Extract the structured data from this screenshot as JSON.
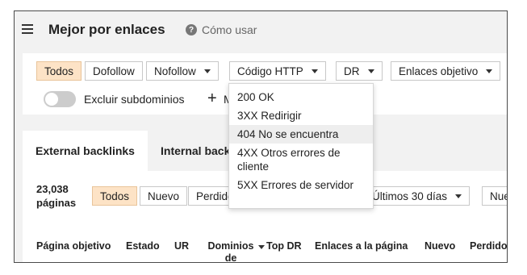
{
  "header": {
    "title": "Mejor por enlaces",
    "help_label": "Cómo usar"
  },
  "filters": {
    "link_type": [
      "Todos",
      "Dofollow",
      "Nofollow"
    ],
    "http_code_label": "Código HTTP",
    "dr_label": "DR",
    "target_links_label": "Enlaces objetivo",
    "exclude_subdomains_label": "Excluir subdominios",
    "exclude_subdomains_on": false,
    "add_filter_partial": "M"
  },
  "http_dropdown": {
    "options": [
      "200 OK",
      "3XX Redirigir",
      "404 No se encuentra",
      "4XX Otros errores de cliente",
      "5XX Errores de servidor"
    ],
    "hovered": "404 No se encuentra"
  },
  "tabs": [
    "External backlinks",
    "Internal backlinks"
  ],
  "results": {
    "count": "23,038",
    "unit": "páginas",
    "segments": [
      "Todos",
      "Nuevo",
      "Perdido"
    ],
    "period_label": "Últimos 30 días",
    "cut_button": "Nue"
  },
  "table": {
    "columns": [
      "Página objetivo",
      "Estado",
      "UR",
      "Dominios de referencia",
      "Top DR",
      "Enlaces a la página",
      "Nuevo",
      "Perdido"
    ]
  },
  "colors": {
    "active_bg": "#fde3c6",
    "panel_bg": "#f2f2f2"
  }
}
